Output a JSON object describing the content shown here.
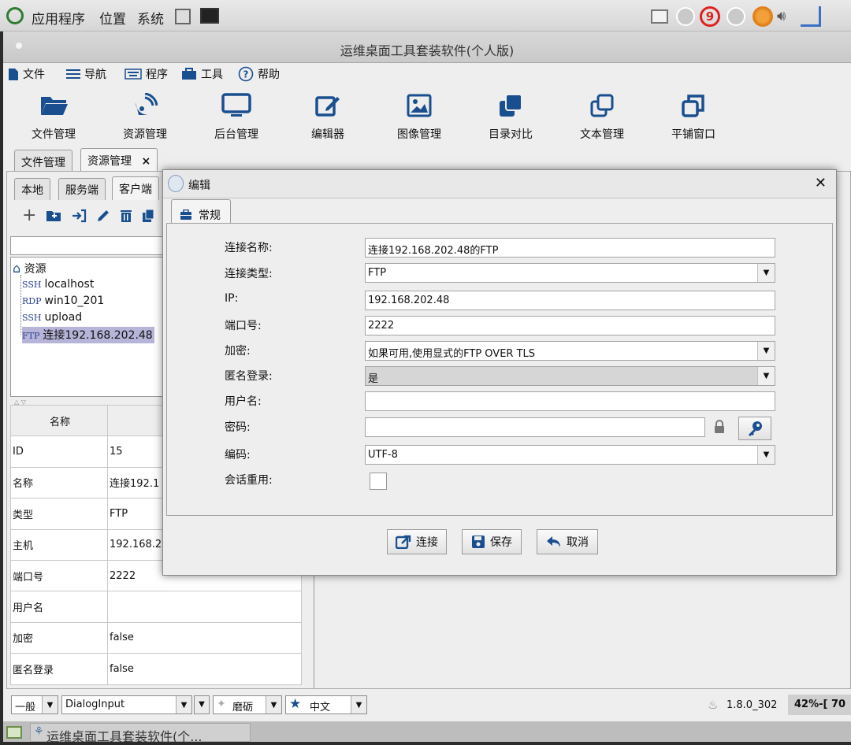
{
  "desktop_panel": {
    "menu_apps": "应用程序",
    "menu_places": "位置",
    "menu_system": "系统",
    "notify_count": "9"
  },
  "window": {
    "title": "运维桌面工具套装软件(个人版)"
  },
  "menubar": [
    "文件",
    "导航",
    "程序",
    "工具",
    "帮助"
  ],
  "toolbar": [
    "文件管理",
    "资源管理",
    "后台管理",
    "编辑器",
    "图像管理",
    "目录对比",
    "文本管理",
    "平铺窗口"
  ],
  "main_tabs": [
    {
      "label": "文件管理"
    },
    {
      "label": "资源管理",
      "close": "×"
    }
  ],
  "sub_tabs": [
    "本地",
    "服务端",
    "客户端"
  ],
  "tree": {
    "root": "资源",
    "items": [
      {
        "proto": "SSH",
        "name": "localhost"
      },
      {
        "proto": "RDP",
        "name": "win10_201"
      },
      {
        "proto": "SSH",
        "name": "upload"
      },
      {
        "proto": "FTP",
        "name": "连接192.168.202.48"
      }
    ]
  },
  "props": {
    "header": "名称",
    "rows": [
      {
        "k": "ID",
        "v": "15"
      },
      {
        "k": "名称",
        "v": "连接192.1"
      },
      {
        "k": "类型",
        "v": "FTP"
      },
      {
        "k": "主机",
        "v": "192.168.2"
      },
      {
        "k": "端口号",
        "v": "2222"
      },
      {
        "k": "用户名",
        "v": ""
      },
      {
        "k": "加密",
        "v": "false"
      },
      {
        "k": "匿名登录",
        "v": "false"
      }
    ]
  },
  "bottom_bar": {
    "style": "一般",
    "font": "DialogInput",
    "theme": "磨砺",
    "lang": "中文",
    "java_version": "1.8.0_302",
    "memory": "42%-[ 70"
  },
  "taskbar": {
    "item": "运维桌面工具套装软件(个..."
  },
  "dialog": {
    "title": "编辑",
    "close": "✕",
    "tab": "常规",
    "fields": {
      "name_label": "连接名称:",
      "name_value": "连接192.168.202.48的FTP",
      "type_label": "连接类型:",
      "type_value": "FTP",
      "ip_label": "IP:",
      "ip_value": "192.168.202.48",
      "port_label": "端口号:",
      "port_value": "2222",
      "encrypt_label": "加密:",
      "encrypt_value": "如果可用,使用显式的FTP OVER TLS",
      "anon_label": "匿名登录:",
      "anon_value": "是",
      "user_label": "用户名:",
      "user_value": "",
      "pass_label": "密码:",
      "pass_value": "",
      "encoding_label": "编码:",
      "encoding_value": "UTF-8",
      "reuse_label": "会话重用:"
    },
    "buttons": {
      "connect": "连接",
      "save": "保存",
      "cancel": "取消"
    }
  },
  "colors": {
    "tree_selection": "#b6b4d8",
    "anon_selected_bg": "#d6d6d6",
    "icon_blue": "#1a4f8f"
  }
}
